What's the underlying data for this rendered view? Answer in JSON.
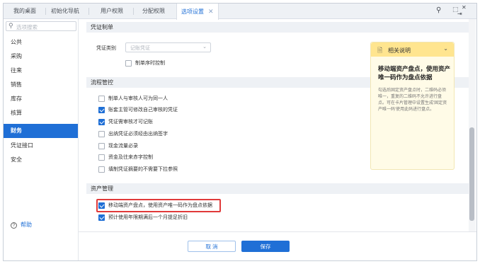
{
  "tabs": [
    {
      "label": "我的桌面"
    },
    {
      "label": "初始化导航"
    },
    {
      "label": "用户权限"
    },
    {
      "label": "分配权限"
    },
    {
      "label": "选项设置",
      "active": true
    }
  ],
  "window_icons": {
    "search": "search-icon",
    "restore": "restore-icon",
    "close": "close-icon"
  },
  "sidebar": {
    "search_placeholder": "选项搜索",
    "items": [
      {
        "label": "公共"
      },
      {
        "label": "采购"
      },
      {
        "label": "往来"
      },
      {
        "label": "销售"
      },
      {
        "label": "库存"
      },
      {
        "label": "核算"
      },
      {
        "label": "财务",
        "active": true
      },
      {
        "label": "凭证接口"
      },
      {
        "label": "安全"
      }
    ],
    "help_label": "帮助"
  },
  "sections": {
    "voucher": {
      "title": "凭证制单",
      "category_label": "凭证类别",
      "category_value": "记账凭证",
      "options": [
        {
          "label": "制单序时控制",
          "checked": false
        }
      ]
    },
    "process": {
      "title": "流程管控",
      "options": [
        {
          "label": "制单人与审核人可为同一人",
          "checked": false
        },
        {
          "label": "账套主管可修改自己审核的凭证",
          "checked": true
        },
        {
          "label": "凭证需审核才可记账",
          "checked": true
        },
        {
          "label": "出纳凭证必须经由出纳签字",
          "checked": false
        },
        {
          "label": "现金流量必录",
          "checked": false
        },
        {
          "label": "资金及往来赤字控制",
          "checked": false
        },
        {
          "label": "填制凭证摘要的不需要下拉参照",
          "checked": false
        }
      ]
    },
    "assets": {
      "title": "资产管理",
      "options": [
        {
          "label": "移动端资产盘点，使用资产唯一码作为盘点依据",
          "checked": true,
          "highlighted": true
        },
        {
          "label": "预计使用年限期满后一个月提足折旧",
          "checked": true
        }
      ]
    }
  },
  "info_panel": {
    "header": "相关说明",
    "title": "移动端资产盘点，使用资产唯一码作为盘点依据",
    "body": "勾选后固定资产盘点时，二维码必须唯一，重复的二维码不允许进行盘点。可在卡片管理中设置生成'固定资产唯一码'使用此码进行盘点。"
  },
  "footer": {
    "cancel_label": "取 消",
    "save_label": "保存"
  },
  "colors": {
    "accent": "#1f6fd6",
    "highlight_border": "#e03a3a",
    "info_header": "#ffe58f",
    "info_bg": "#fffbe7"
  }
}
